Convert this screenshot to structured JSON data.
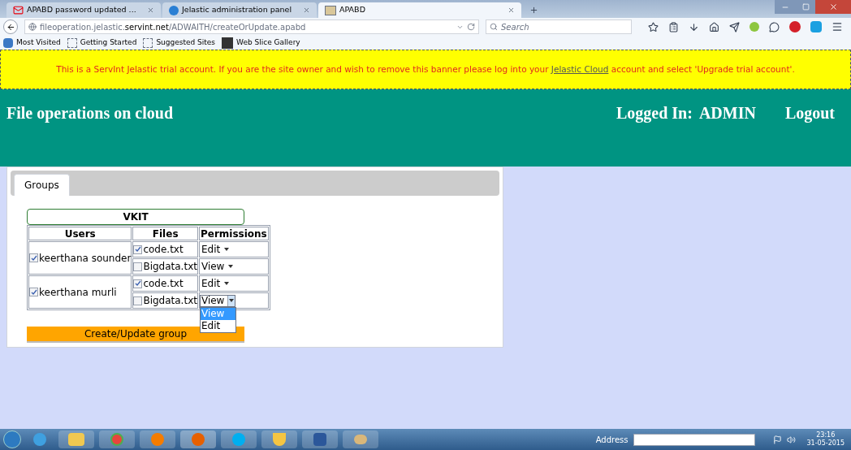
{
  "browser": {
    "tabs": [
      {
        "title": "APABD password updated ...",
        "selected": false
      },
      {
        "title": "Jelastic administration panel",
        "selected": false
      },
      {
        "title": "APABD",
        "selected": true
      }
    ],
    "url": {
      "host_start": "fileoperation.jelastic.",
      "host_bold": "servint.net",
      "path": "/ADWAITH/createOrUpdate.apabd"
    },
    "search": {
      "placeholder": "Search"
    },
    "bookmarks": [
      {
        "label": "Most Visited"
      },
      {
        "label": "Getting Started"
      },
      {
        "label": "Suggested Sites"
      },
      {
        "label": "Web Slice Gallery"
      }
    ]
  },
  "banner": {
    "before": "This is a ServInt Jelastic trial account. If you are the site owner and wish to remove this banner please log into your ",
    "link": "Jelastic Cloud",
    "after": " account and select 'Upgrade trial account'."
  },
  "header": {
    "title": "File operations on cloud",
    "logged_in_label": "Logged In:",
    "user": "ADMIN",
    "logout": "Logout"
  },
  "panel": {
    "tabs": [
      {
        "label": "Groups",
        "selected": true
      }
    ],
    "group_name": "VKIT",
    "columns": [
      "Users",
      "Files",
      "Permissions"
    ],
    "users": [
      {
        "name": "keerthana sounder",
        "checked": true,
        "files": [
          {
            "name": "code.txt",
            "checked": true,
            "permission": "Edit",
            "open": false
          },
          {
            "name": "Bigdata.txt",
            "checked": false,
            "permission": "View",
            "open": false
          }
        ]
      },
      {
        "name": "keerthana murli",
        "checked": true,
        "files": [
          {
            "name": "code.txt",
            "checked": true,
            "permission": "Edit",
            "open": false
          },
          {
            "name": "Bigdata.txt",
            "checked": false,
            "permission": "View",
            "open": true,
            "options": [
              {
                "label": "View",
                "selected": true
              },
              {
                "label": "Edit",
                "selected": false
              }
            ]
          }
        ]
      }
    ],
    "submit": "Create/Update group"
  },
  "taskbar": {
    "address_label": "Address",
    "time": "23:16",
    "date": "31-05-2015"
  }
}
